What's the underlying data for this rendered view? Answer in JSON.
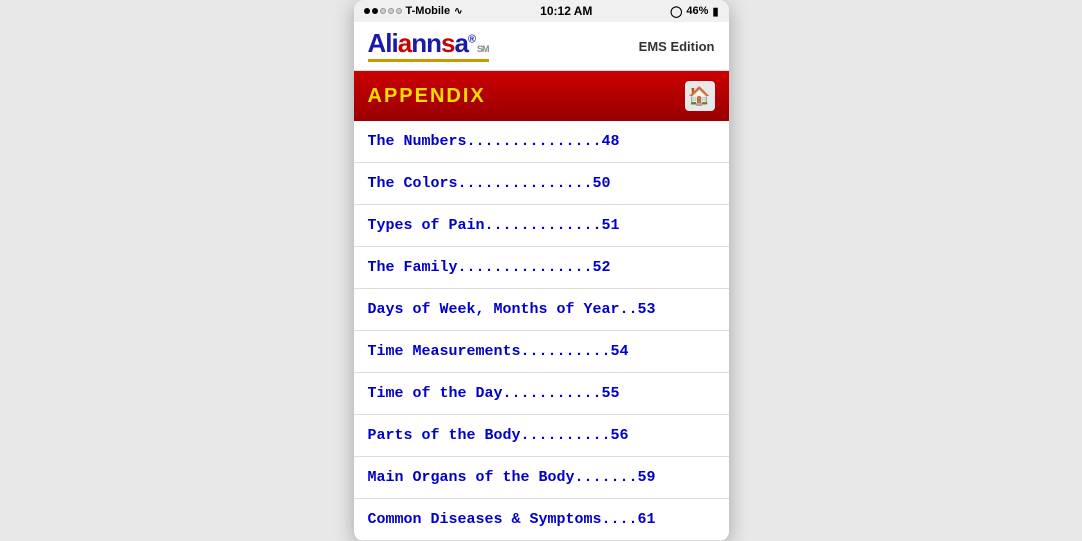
{
  "statusBar": {
    "carrier": "T-Mobile",
    "time": "10:12 AM",
    "battery": "46%",
    "signal": [
      "filled",
      "filled",
      "empty",
      "empty",
      "empty"
    ]
  },
  "header": {
    "logoText": "Aliannsa",
    "logoSm": "SM",
    "registered": "®",
    "emsEdition": "EMS Edition",
    "underlineColor": "#cc9900"
  },
  "appendix": {
    "title": "APPENDIX",
    "homeLabel": "🏠"
  },
  "tocItems": [
    {
      "label": "The Numbers",
      "dots": "...............",
      "page": "48"
    },
    {
      "label": "The Colors",
      "dots": "...............",
      "page": "50"
    },
    {
      "label": "Types of Pain",
      "dots": ".............",
      "page": "51"
    },
    {
      "label": "The Family",
      "dots": "...............",
      "page": "52"
    },
    {
      "label": "Days of Week, Months of Year",
      "dots": "..",
      "page": "53"
    },
    {
      "label": "Time Measurements",
      "dots": "..........",
      "page": "54"
    },
    {
      "label": "Time of the Day",
      "dots": "...........",
      "page": "55"
    },
    {
      "label": "Parts of the Body",
      "dots": "..........",
      "page": "56"
    },
    {
      "label": "Main Organs of the Body",
      "dots": ".......",
      "page": "59"
    },
    {
      "label": "Common Diseases & Symptoms",
      "dots": "....",
      "page": "61"
    }
  ]
}
